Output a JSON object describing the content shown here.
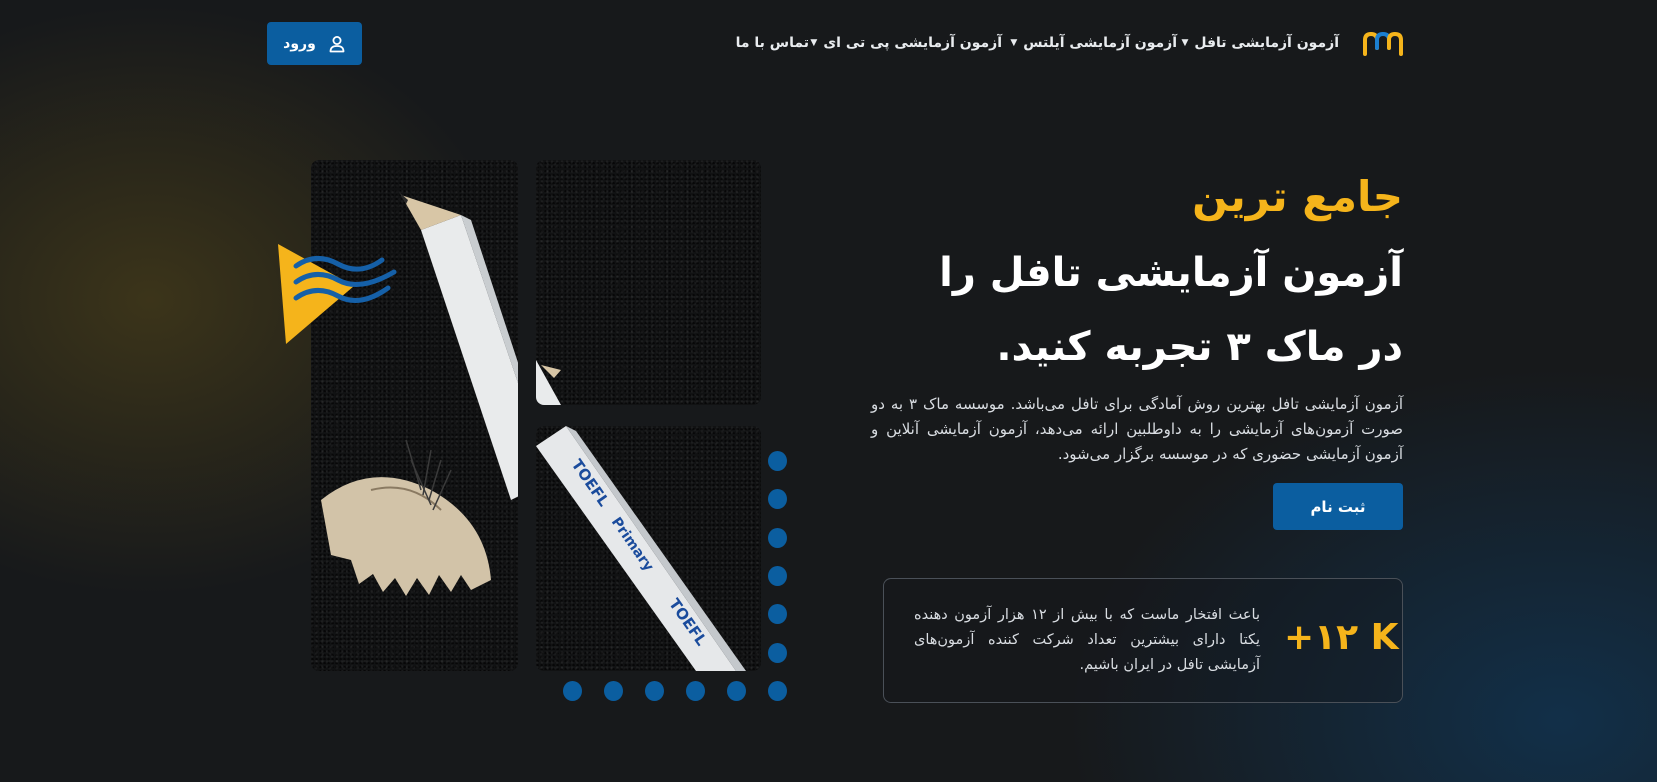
{
  "header": {
    "logo_icon": "mac-logo-icon",
    "nav": [
      {
        "label": "آزمون آزمایشی تافل",
        "has_dropdown": true
      },
      {
        "label": "آزمون آزمایشی آیلتس",
        "has_dropdown": true
      },
      {
        "label": "آزمون آزمایشی پی تی ای",
        "has_dropdown": true
      },
      {
        "label": "تماس با ما",
        "has_dropdown": false
      }
    ],
    "login_label": "ورود",
    "login_icon": "user-icon"
  },
  "hero": {
    "accent_title": "جامع ترین",
    "title": "آزمون آزمایشی تافل را در ماک ۳ تجربه کنید.",
    "description": "آزمون آزمایشی تافل بهترین روش آمادگی برای تافل می‌باشد. موسسه ماک ۳ به دو صورت آزمون‌های آزمایشی را به داوطلبین ارائه می‌دهد، آزمون آزمایشی آنلاین و آزمون آزمایشی حضوری که در موسسه برگزار می‌شود.",
    "register_label": "ثبت نام"
  },
  "stats": {
    "number": "+۱۲ K",
    "text": "باعث افتخار ماست که با بیش از ۱۲ هزار آزمون دهنده یکتا دارای بیشترین تعداد شرکت کننده آزمون‌های آزمایشی تافل در ایران باشیم."
  },
  "images": {
    "pencil_text_1": "TOEFL",
    "pencil_text_2": "Primary",
    "pencil_text_3": "TOEFL"
  },
  "colors": {
    "accent": "#f5b41b",
    "primary": "#0b5ea0",
    "background": "#17191b"
  }
}
